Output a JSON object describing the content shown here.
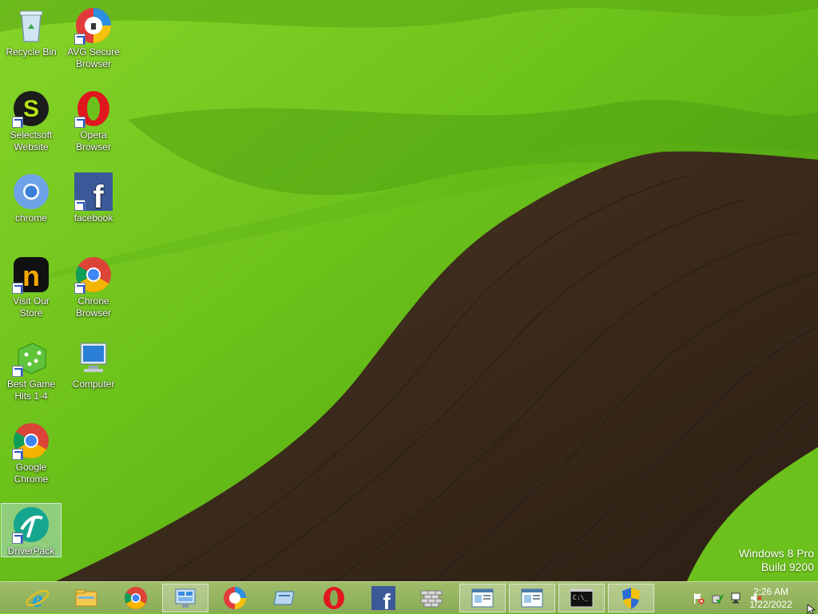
{
  "desktop_icons": [
    {
      "label": "Recycle Bin",
      "icon": "recycle-bin-icon"
    },
    {
      "label": "AVG Secure Browser",
      "icon": "avg-browser-icon"
    },
    {
      "label": "Selectsoft Website",
      "icon": "selectsoft-icon"
    },
    {
      "label": "Opera Browser",
      "icon": "opera-icon"
    },
    {
      "label": "chrome",
      "icon": "chromium-icon"
    },
    {
      "label": "facebook",
      "icon": "facebook-icon"
    },
    {
      "label": "Visit Our Store",
      "icon": "store-icon"
    },
    {
      "label": "Chrone Browser",
      "icon": "chrome-browser-icon"
    },
    {
      "label": "Best Game Hits 1-4",
      "icon": "dice-icon"
    },
    {
      "label": "Computer",
      "icon": "computer-icon"
    },
    {
      "label": "Google Chrome",
      "icon": "google-chrome-icon"
    },
    {
      "label": "DriverPack",
      "icon": "driverpack-icon"
    }
  ],
  "watermark": {
    "line1": "Windows 8 Pro",
    "line2": "Build 9200"
  },
  "taskbar": {
    "items": [
      {
        "name": "internet-explorer-icon"
      },
      {
        "name": "file-explorer-icon"
      },
      {
        "name": "chrome-icon"
      },
      {
        "name": "control-panel-icon"
      },
      {
        "name": "avg-browser-icon"
      },
      {
        "name": "window-app-icon"
      },
      {
        "name": "opera-icon"
      },
      {
        "name": "facebook-icon"
      },
      {
        "name": "firewall-icon"
      },
      {
        "name": "document-window-icon"
      },
      {
        "name": "document-window-icon"
      },
      {
        "name": "command-prompt-icon"
      },
      {
        "name": "uac-shield-icon"
      }
    ]
  },
  "tray": {
    "time": "2:26 AM",
    "date": "1/22/2022",
    "icons": [
      "action-center-flag-icon",
      "security-check-icon",
      "network-icon",
      "volume-muted-icon"
    ]
  },
  "colors": {
    "taskbar": "#8aab55",
    "wallpaper_green": "#6bc21a",
    "field_brown": "#3b2a1c"
  }
}
